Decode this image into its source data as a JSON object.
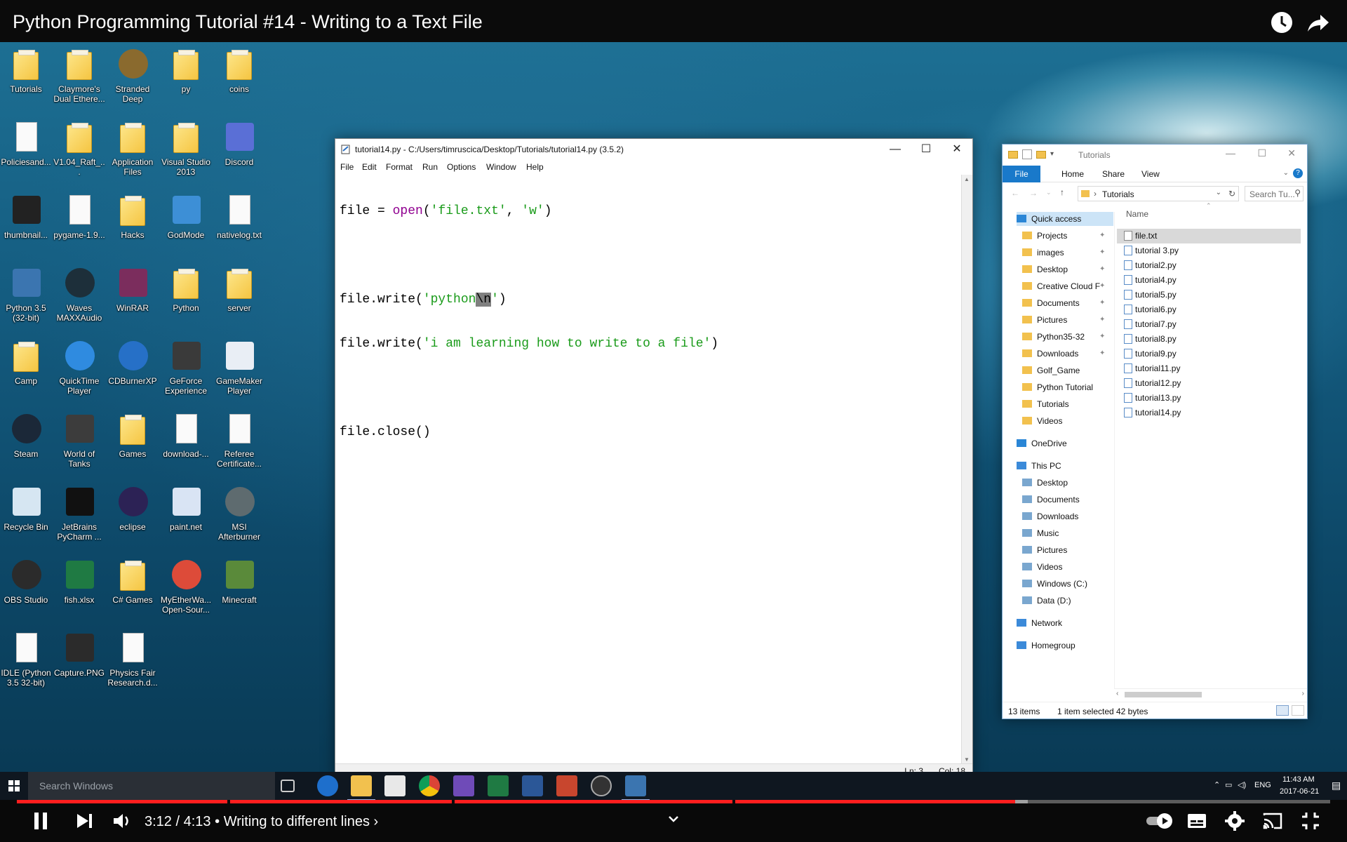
{
  "video": {
    "title": "Python Programming Tutorial #14 - Writing to a Text File",
    "time_current": "3:12",
    "time_total": "4:13",
    "chapter": "Writing to different lines",
    "progress_fraction": 0.76,
    "buffer_fraction": 0.77
  },
  "desktop_icons": [
    {
      "label": "Tutorials",
      "kind": "folder"
    },
    {
      "label": "Claymore's Dual Ethere...",
      "kind": "folder"
    },
    {
      "label": "Stranded Deep",
      "kind": "round",
      "color": "#8a6a2e"
    },
    {
      "label": "py",
      "kind": "folder"
    },
    {
      "label": "coins",
      "kind": "folder"
    },
    {
      "label": "Policiesand...",
      "kind": "doc"
    },
    {
      "label": "V1.04_Raft_...",
      "kind": "folder"
    },
    {
      "label": "Application Files",
      "kind": "folder"
    },
    {
      "label": "Visual Studio 2013",
      "kind": "folder"
    },
    {
      "label": "Discord",
      "kind": "sq",
      "color": "#5a6fd6"
    },
    {
      "label": "thumbnail...",
      "kind": "sq",
      "color": "#222222"
    },
    {
      "label": "pygame-1.9...",
      "kind": "doc"
    },
    {
      "label": "Hacks",
      "kind": "folder"
    },
    {
      "label": "GodMode",
      "kind": "sq",
      "color": "#3d8fd6"
    },
    {
      "label": "nativelog.txt",
      "kind": "doc"
    },
    {
      "label": "Python 3.5 (32-bit)",
      "kind": "sq",
      "color": "#3b75b0"
    },
    {
      "label": "Waves MAXXAudio",
      "kind": "round",
      "color": "#1d2f3a"
    },
    {
      "label": "WinRAR",
      "kind": "sq",
      "color": "#7b2d5d"
    },
    {
      "label": "Python",
      "kind": "folder"
    },
    {
      "label": "server",
      "kind": "folder"
    },
    {
      "label": "Camp",
      "kind": "folder"
    },
    {
      "label": "QuickTime Player",
      "kind": "round",
      "color": "#2f8be0"
    },
    {
      "label": "CDBurnerXP",
      "kind": "round",
      "color": "#2670c7"
    },
    {
      "label": "GeForce Experience",
      "kind": "sq",
      "color": "#3a3a3a"
    },
    {
      "label": "GameMaker Player",
      "kind": "sq",
      "color": "#e9eef5"
    },
    {
      "label": "Steam",
      "kind": "round",
      "color": "#1b2838"
    },
    {
      "label": "World of Tanks",
      "kind": "sq",
      "color": "#3c3c3c"
    },
    {
      "label": "Games",
      "kind": "folder"
    },
    {
      "label": "download-...",
      "kind": "doc"
    },
    {
      "label": "Referee Certificate...",
      "kind": "doc"
    },
    {
      "label": "Recycle Bin",
      "kind": "sq",
      "color": "#d6e6f2"
    },
    {
      "label": "JetBrains PyCharm ...",
      "kind": "sq",
      "color": "#111111"
    },
    {
      "label": "eclipse",
      "kind": "round",
      "color": "#2c2255"
    },
    {
      "label": "paint.net",
      "kind": "sq",
      "color": "#d9e4f4"
    },
    {
      "label": "MSI Afterburner",
      "kind": "round",
      "color": "#5e6b6f"
    },
    {
      "label": "OBS Studio",
      "kind": "round",
      "color": "#2b2b2b"
    },
    {
      "label": "fish.xlsx",
      "kind": "sq",
      "color": "#1f7a43"
    },
    {
      "label": "C# Games",
      "kind": "folder"
    },
    {
      "label": "MyEtherWa... Open-Sour...",
      "kind": "round",
      "color": "#dd4b39"
    },
    {
      "label": "Minecraft",
      "kind": "sq",
      "color": "#5a8a3a"
    },
    {
      "label": "IDLE (Python 3.5 32-bit)",
      "kind": "doc"
    },
    {
      "label": "Capture.PNG",
      "kind": "sq",
      "color": "#2b2b2b"
    },
    {
      "label": "Physics Fair Research.d...",
      "kind": "doc"
    }
  ],
  "idle": {
    "title": "tutorial14.py - C:/Users/timruscica/Desktop/Tutorials/tutorial14.py (3.5.2)",
    "menu": [
      "File",
      "Edit",
      "Format",
      "Run",
      "Options",
      "Window",
      "Help"
    ],
    "code": {
      "l1_a": "file = ",
      "l1_fn": "open",
      "l1_b": "(",
      "l1_s1": "'file.txt'",
      "l1_c": ", ",
      "l1_s2": "'w'",
      "l1_d": ")",
      "l3_a": "file.write(",
      "l3_s1": "'python",
      "l3_sel": "\\n",
      "l3_s2": "'",
      "l3_b": ")",
      "l4_a": "file.write(",
      "l4_s": "'i am learning how to write to a file'",
      "l4_b": ")",
      "l6": "file.close()"
    },
    "status_ln": "Ln: 3",
    "status_col": "Col: 18"
  },
  "explorer": {
    "title": "Tutorials",
    "tabs": [
      "File",
      "Home",
      "Share",
      "View"
    ],
    "address": "Tutorials",
    "search_placeholder": "Search Tu...",
    "column_name": "Name",
    "nav": {
      "quick_access": "Quick access",
      "pinned": [
        "Projects",
        "images",
        "Desktop",
        "Creative Cloud F",
        "Documents",
        "Pictures",
        "Python35-32",
        "Downloads"
      ],
      "unpinned": [
        "Golf_Game",
        "Python Tutorial",
        "Tutorials",
        "Videos"
      ],
      "onedrive": "OneDrive",
      "this_pc": "This PC",
      "pc_items": [
        "Desktop",
        "Documents",
        "Downloads",
        "Music",
        "Pictures",
        "Videos",
        "Windows (C:)",
        "Data (D:)"
      ],
      "network": "Network",
      "homegroup": "Homegroup"
    },
    "files": [
      "file.txt",
      "tutorial 3.py",
      "tutorial2.py",
      "tutorial4.py",
      "tutorial5.py",
      "tutorial6.py",
      "tutorial7.py",
      "tutorial8.py",
      "tutorial9.py",
      "tutorial11.py",
      "tutorial12.py",
      "tutorial13.py",
      "tutorial14.py"
    ],
    "status_count": "13 items",
    "status_selected": "1 item selected",
    "status_size": "42 bytes"
  },
  "taskbar": {
    "search_placeholder": "Search Windows",
    "lang": "ENG",
    "clock_time": "11:43 AM",
    "clock_date": "2017-06-21"
  }
}
